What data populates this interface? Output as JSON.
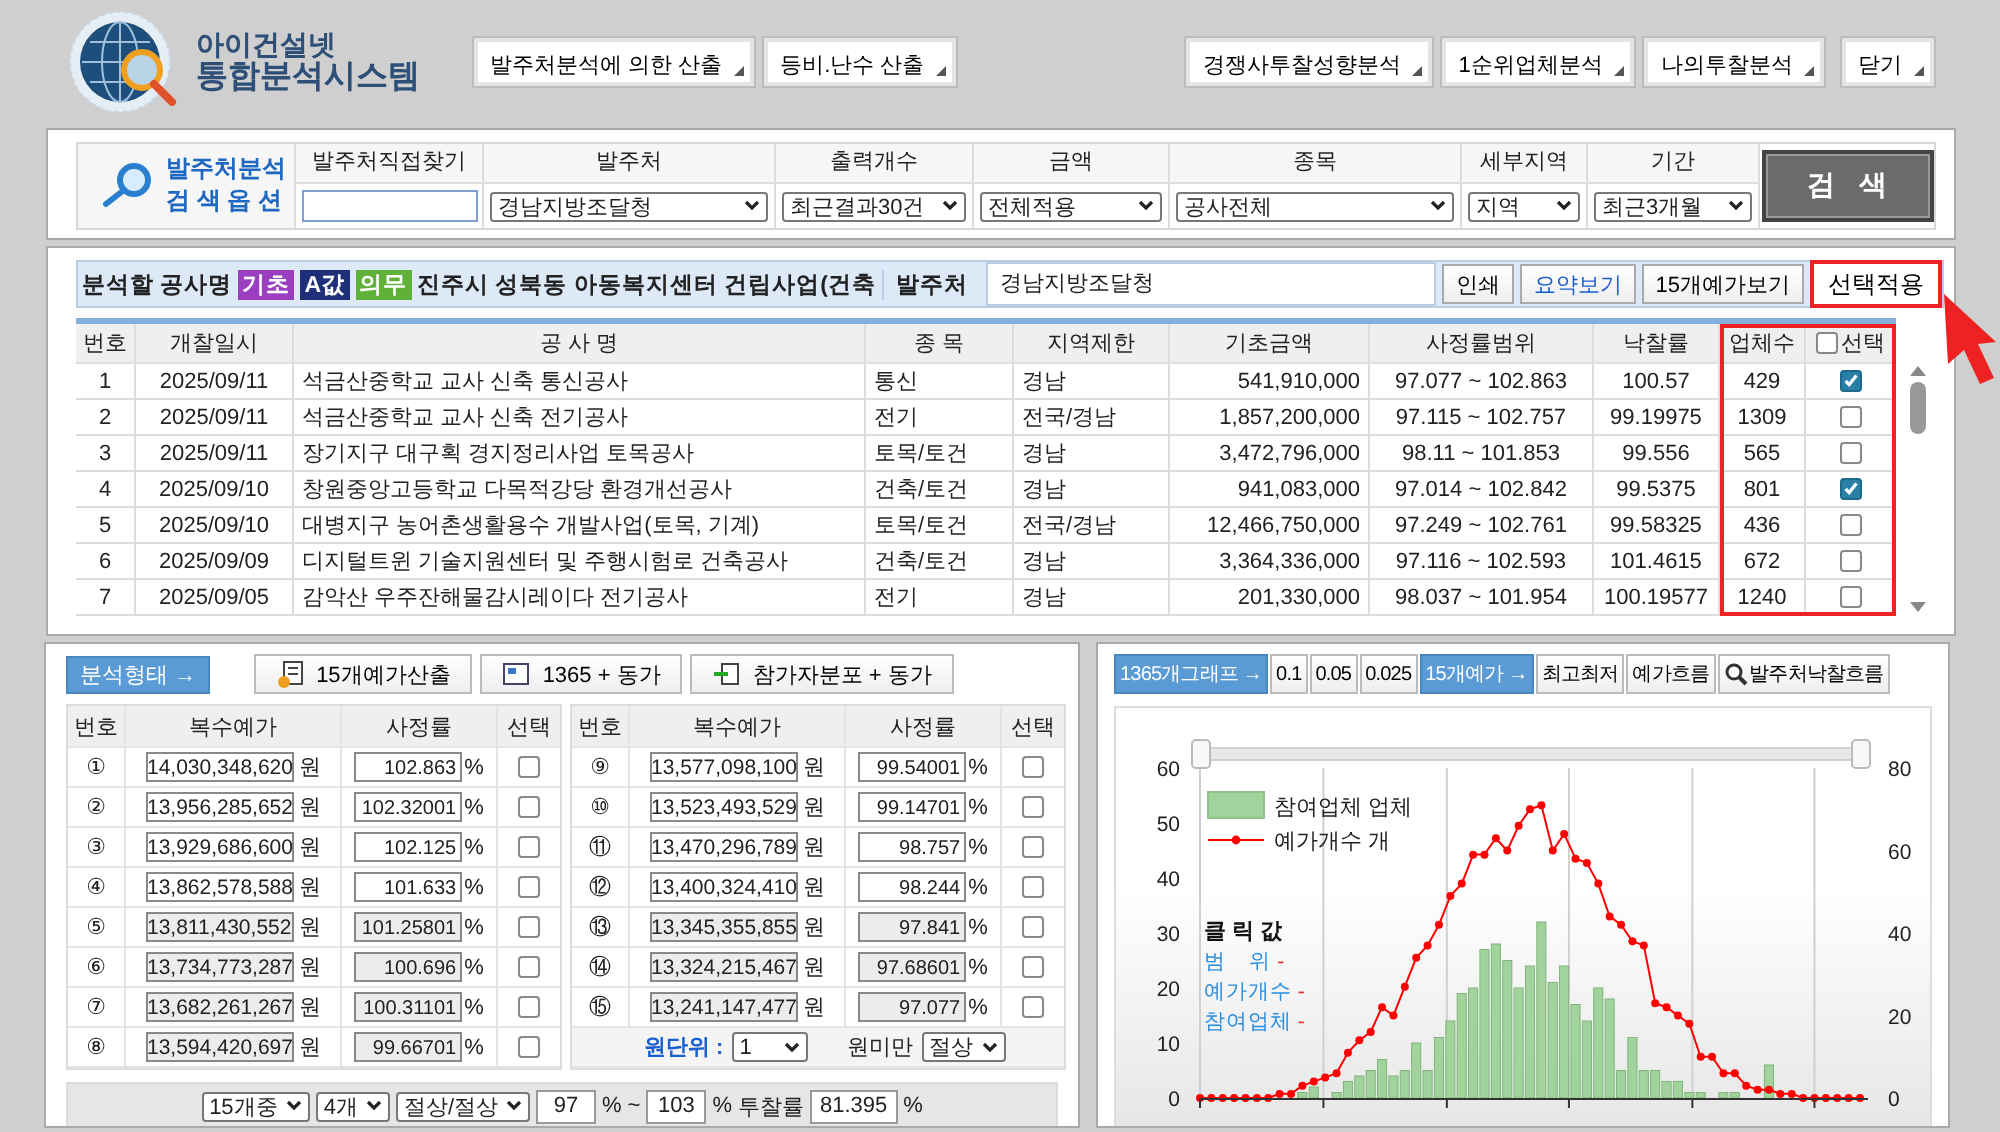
{
  "header": {
    "logo_title": "아이건설넷",
    "logo_subtitle": "통합분석시스템",
    "nav_groups": [
      [
        "발주처분석에 의한 산출",
        "등비.난수 산출"
      ],
      [
        "경쟁사투찰성향분석",
        "1순위업체분석",
        "나의투찰분석"
      ]
    ],
    "close_button": "닫기"
  },
  "search": {
    "title": [
      "발주처분석",
      "검 색 옵 션"
    ],
    "fields": [
      {
        "label": "발주처직접찾기",
        "kind": "text"
      },
      {
        "label": "발주처",
        "kind": "select",
        "value": "경남지방조달청"
      },
      {
        "label": "출력개수",
        "kind": "select",
        "value": "최근결과30건"
      },
      {
        "label": "금액",
        "kind": "select",
        "value": "전체적용"
      },
      {
        "label": "종목",
        "kind": "select",
        "value": "공사전체"
      },
      {
        "label": "세부지역",
        "kind": "select",
        "value": "지역"
      },
      {
        "label": "기간",
        "kind": "select",
        "value": "최근3개월"
      }
    ],
    "button": "검   색"
  },
  "project": {
    "label": "분석할 공사명",
    "tags": [
      {
        "text": "기초",
        "color": "#9b3fc0"
      },
      {
        "text": "A값",
        "color": "#1f2f7a"
      },
      {
        "text": "의무",
        "color": "#5fb13a"
      }
    ],
    "name": "진주시 성북동 아동복지센터 건립사업(건축",
    "agency_label": "발주처",
    "agency_value": "경남지방조달청",
    "buttons": [
      {
        "label": "인쇄",
        "kind": "plain"
      },
      {
        "label": "요약보기",
        "kind": "link"
      },
      {
        "label": "15개예가보기",
        "kind": "plain"
      },
      {
        "label": "선택적용",
        "kind": "highlighted"
      }
    ]
  },
  "table": {
    "columns": [
      {
        "label": "번호",
        "highlighted": false
      },
      {
        "label": "개찰일시",
        "highlighted": false
      },
      {
        "label": "공 사 명",
        "highlighted": false
      },
      {
        "label": "종 목",
        "highlighted": false
      },
      {
        "label": "지역제한",
        "highlighted": false
      },
      {
        "label": "기초금액",
        "highlighted": false
      },
      {
        "label": "사정률범위",
        "highlighted": false
      },
      {
        "label": "낙찰률",
        "highlighted": false
      },
      {
        "label": "업체수",
        "highlighted": true
      },
      {
        "label": "선택",
        "highlighted": true,
        "checked": false
      }
    ],
    "rows": [
      {
        "cells": [
          "1",
          "2025/09/11",
          "석금산중학교 교사 신축 통신공사",
          "통신",
          "경남",
          "541,910,000",
          "97.077 ~ 102.863",
          "100.57",
          "429"
        ],
        "checked": true
      },
      {
        "cells": [
          "2",
          "2025/09/11",
          "석금산중학교 교사 신축 전기공사",
          "전기",
          "전국/경남",
          "1,857,200,000",
          "97.115 ~ 102.757",
          "99.19975",
          "1309"
        ],
        "checked": false
      },
      {
        "cells": [
          "3",
          "2025/09/11",
          "장기지구 대구획 경지정리사업 토목공사",
          "토목/토건",
          "경남",
          "3,472,796,000",
          "98.11 ~ 101.853",
          "99.556",
          "565"
        ],
        "checked": false
      },
      {
        "cells": [
          "4",
          "2025/09/10",
          "창원중앙고등학교 다목적강당 환경개선공사",
          "건축/토건",
          "경남",
          "941,083,000",
          "97.014 ~ 102.842",
          "99.5375",
          "801"
        ],
        "checked": true
      },
      {
        "cells": [
          "5",
          "2025/09/10",
          "대병지구 농어촌생활용수 개발사업(토목, 기계)",
          "토목/토건",
          "전국/경남",
          "12,466,750,000",
          "97.249 ~ 102.761",
          "99.58325",
          "436"
        ],
        "checked": false
      },
      {
        "cells": [
          "6",
          "2025/09/09",
          "디지털트윈 기술지원센터 및 주행시험로 건축공사",
          "건축/토건",
          "경남",
          "3,364,336,000",
          "97.116 ~ 102.593",
          "101.4615",
          "672"
        ],
        "checked": false
      },
      {
        "cells": [
          "7",
          "2025/09/05",
          "감악산 우주잔해물감시레이다 전기공사",
          "전기",
          "경남",
          "201,330,000",
          "98.037 ~ 101.954",
          "100.19577",
          "1240"
        ],
        "checked": false
      }
    ]
  },
  "analysis": {
    "label": "분석형태 →",
    "tools": [
      {
        "label": "15개예가산출"
      },
      {
        "label": "1365 + 동가"
      },
      {
        "label": "참가자분포 + 동가"
      }
    ],
    "tables": [
      {
        "columns": [
          "번호",
          "복수예가",
          "사정률",
          "선택"
        ],
        "rows": [
          {
            "no": "①",
            "price": "14,030,348,620",
            "price_unit": "원",
            "rate": "102.863",
            "rate_unit": "%",
            "checked": false,
            "disabled": false
          },
          {
            "no": "②",
            "price": "13,956,285,652",
            "price_unit": "원",
            "rate": "102.32001",
            "rate_unit": "%",
            "checked": false,
            "disabled": false
          },
          {
            "no": "③",
            "price": "13,929,686,600",
            "price_unit": "원",
            "rate": "102.125",
            "rate_unit": "%",
            "checked": false,
            "disabled": false
          },
          {
            "no": "④",
            "price": "13,862,578,588",
            "price_unit": "원",
            "rate": "101.633",
            "rate_unit": "%",
            "checked": false,
            "disabled": false
          },
          {
            "no": "⑤",
            "price": "13,811,430,552",
            "price_unit": "원",
            "rate": "101.25801",
            "rate_unit": "%",
            "checked": false,
            "disabled": true
          },
          {
            "no": "⑥",
            "price": "13,734,773,287",
            "price_unit": "원",
            "rate": "100.696",
            "rate_unit": "%",
            "checked": false,
            "disabled": true
          },
          {
            "no": "⑦",
            "price": "13,682,261,267",
            "price_unit": "원",
            "rate": "100.31101",
            "rate_unit": "%",
            "checked": false,
            "disabled": true
          },
          {
            "no": "⑧",
            "price": "13,594,420,697",
            "price_unit": "원",
            "rate": "99.66701",
            "rate_unit": "%",
            "checked": false,
            "disabled": true
          }
        ]
      },
      {
        "columns": [
          "번호",
          "복수예가",
          "사정률",
          "선택"
        ],
        "rows": [
          {
            "no": "⑨",
            "price": "13,577,098,100",
            "price_unit": "원",
            "rate": "99.54001",
            "rate_unit": "%",
            "checked": false,
            "disabled": false
          },
          {
            "no": "⑩",
            "price": "13,523,493,529",
            "price_unit": "원",
            "rate": "99.14701",
            "rate_unit": "%",
            "checked": false,
            "disabled": false
          },
          {
            "no": "⑪",
            "price": "13,470,296,789",
            "price_unit": "원",
            "rate": "98.757",
            "rate_unit": "%",
            "checked": false,
            "disabled": false
          },
          {
            "no": "⑫",
            "price": "13,400,324,410",
            "price_unit": "원",
            "rate": "98.244",
            "rate_unit": "%",
            "checked": false,
            "disabled": false
          },
          {
            "no": "⑬",
            "price": "13,345,355,855",
            "price_unit": "원",
            "rate": "97.841",
            "rate_unit": "%",
            "checked": false,
            "disabled": true
          },
          {
            "no": "⑭",
            "price": "13,324,215,467",
            "price_unit": "원",
            "rate": "97.68601",
            "rate_unit": "%",
            "checked": false,
            "disabled": true
          },
          {
            "no": "⑮",
            "price": "13,241,147,477",
            "price_unit": "원",
            "rate": "97.077",
            "rate_unit": "%",
            "checked": false,
            "disabled": true
          }
        ],
        "footer": {
          "unit_label": "원단위 :",
          "unit_value": "1",
          "below_label": "원미만",
          "below_value": "절상"
        }
      }
    ],
    "controls": [
      {
        "kind": "select",
        "value": "15개중"
      },
      {
        "kind": "select",
        "value": "4개"
      },
      {
        "kind": "select",
        "value": "절상/절상"
      },
      {
        "kind": "input",
        "value": "97"
      },
      {
        "kind": "text",
        "value": "%"
      },
      {
        "kind": "text",
        "value": "~"
      },
      {
        "kind": "input",
        "value": "103"
      },
      {
        "kind": "text",
        "value": "%"
      },
      {
        "kind": "text",
        "value": "투찰률"
      },
      {
        "kind": "input",
        "value": "81.395"
      },
      {
        "kind": "text",
        "value": "%"
      }
    ]
  },
  "graph": {
    "buttons": [
      {
        "label": "1365개그래프 →",
        "kind": "accent"
      },
      {
        "label": "0.1",
        "kind": "plain"
      },
      {
        "label": "0.05",
        "kind": "plain"
      },
      {
        "label": "0.025",
        "kind": "plain"
      },
      {
        "label": "15개예가 →",
        "kind": "accent"
      },
      {
        "label": "최고최저",
        "kind": "plain"
      },
      {
        "label": "예가흐름",
        "kind": "plain"
      },
      {
        "label": "발주처낙찰흐름",
        "kind": "search"
      }
    ],
    "click_info": {
      "title": "클 릭 값",
      "rows": [
        "범    위 -",
        "예가개수 -",
        "참여업체 -"
      ]
    },
    "chart_data": {
      "type": "bar",
      "legend": "upper left",
      "ylim": [
        0,
        60
      ],
      "yticks": [
        0,
        10,
        20,
        30,
        40,
        50,
        60
      ],
      "y2lim": [
        0,
        80
      ],
      "y2ticks": [
        0,
        20,
        40,
        60,
        80
      ],
      "series": [
        {
          "name": "참여업체 업체",
          "type": "bar",
          "color": "#a3d39c",
          "values": [
            0,
            0,
            0,
            0,
            0,
            0,
            0,
            0,
            0,
            1,
            2,
            0,
            1,
            3,
            4,
            5,
            7,
            4,
            5,
            10,
            5,
            11,
            14,
            19,
            20,
            27,
            28,
            25,
            20,
            24,
            32,
            21,
            24,
            17,
            14,
            20,
            18,
            5,
            11,
            5,
            5,
            3,
            3,
            1,
            1,
            0,
            1,
            1,
            0,
            0,
            6,
            0,
            0,
            0,
            0,
            0,
            0,
            0,
            0
          ]
        },
        {
          "name": "예가개수 개",
          "type": "line",
          "axis": "y2",
          "marker": "o",
          "color": "#ff0000",
          "values": [
            0,
            0,
            0,
            0,
            0,
            0,
            0,
            1,
            1,
            3,
            4,
            5,
            6,
            11,
            14,
            16,
            22,
            20,
            27,
            34,
            37,
            42,
            49,
            52,
            59,
            59,
            63,
            60,
            66,
            70,
            71,
            60,
            64,
            58,
            57,
            52,
            44,
            42,
            38,
            37,
            23,
            22,
            20,
            18,
            10,
            10,
            6,
            6,
            3,
            2,
            2,
            1,
            1,
            0,
            0,
            0,
            0,
            0,
            0
          ]
        }
      ]
    }
  }
}
